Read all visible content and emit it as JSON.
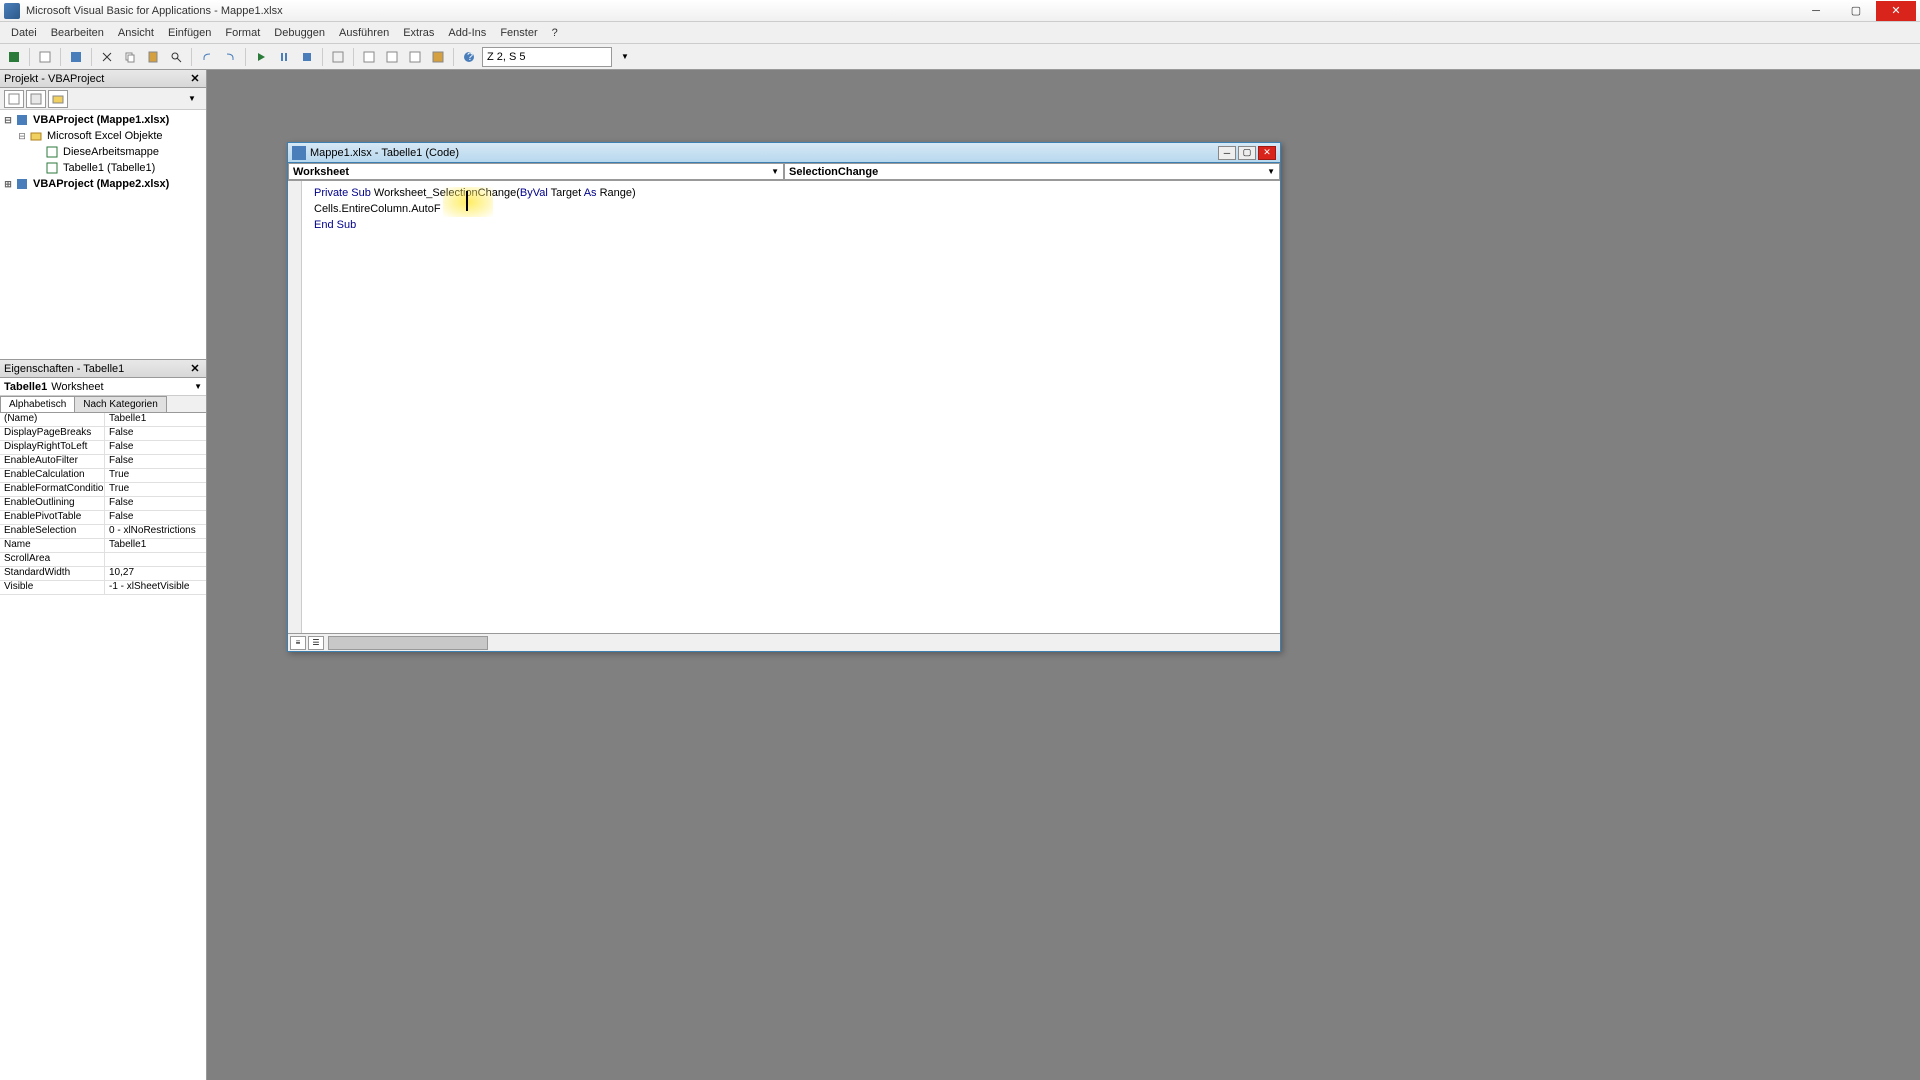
{
  "title": "Microsoft Visual Basic for Applications - Mappe1.xlsx",
  "menu": {
    "items": [
      "Datei",
      "Bearbeiten",
      "Ansicht",
      "Einfügen",
      "Format",
      "Debuggen",
      "Ausführen",
      "Extras",
      "Add-Ins",
      "Fenster",
      "?"
    ]
  },
  "toolbar": {
    "position": "Z 2, S 5"
  },
  "project_panel": {
    "title": "Projekt - VBAProject",
    "tree": [
      {
        "label": "VBAProject (Mappe1.xlsx)",
        "level": 0,
        "bold": true,
        "expanded": true,
        "icon": "project"
      },
      {
        "label": "Microsoft Excel Objekte",
        "level": 1,
        "bold": false,
        "expanded": true,
        "icon": "folder"
      },
      {
        "label": "DieseArbeitsmappe",
        "level": 2,
        "bold": false,
        "expanded": false,
        "icon": "sheet"
      },
      {
        "label": "Tabelle1 (Tabelle1)",
        "level": 2,
        "bold": false,
        "expanded": false,
        "icon": "sheet"
      },
      {
        "label": "VBAProject (Mappe2.xlsx)",
        "level": 0,
        "bold": true,
        "expanded": false,
        "icon": "project"
      }
    ]
  },
  "props_panel": {
    "title": "Eigenschaften - Tabelle1",
    "object_name": "Tabelle1",
    "object_type": "Worksheet",
    "tabs": [
      "Alphabetisch",
      "Nach Kategorien"
    ],
    "rows": [
      {
        "name": "(Name)",
        "value": "Tabelle1"
      },
      {
        "name": "DisplayPageBreaks",
        "value": "False"
      },
      {
        "name": "DisplayRightToLeft",
        "value": "False"
      },
      {
        "name": "EnableAutoFilter",
        "value": "False"
      },
      {
        "name": "EnableCalculation",
        "value": "True"
      },
      {
        "name": "EnableFormatConditionsCalc",
        "value": "True"
      },
      {
        "name": "EnableOutlining",
        "value": "False"
      },
      {
        "name": "EnablePivotTable",
        "value": "False"
      },
      {
        "name": "EnableSelection",
        "value": "0 - xlNoRestrictions"
      },
      {
        "name": "Name",
        "value": "Tabelle1"
      },
      {
        "name": "ScrollArea",
        "value": ""
      },
      {
        "name": "StandardWidth",
        "value": "10,27"
      },
      {
        "name": "Visible",
        "value": "-1 - xlSheetVisible"
      }
    ]
  },
  "code_window": {
    "title": "Mappe1.xlsx - Tabelle1 (Code)",
    "object_selector": "Worksheet",
    "proc_selector": "SelectionChange",
    "code": {
      "line1_pre": "Private Sub",
      "line1_mid": " Worksheet_SelectionChange(",
      "line1_byval": "ByVal",
      "line1_post1": " Target ",
      "line1_as": "As",
      "line1_post2": " Range)",
      "line2": "Cells.EntireColumn.AutoF",
      "line3": "End Sub"
    }
  }
}
